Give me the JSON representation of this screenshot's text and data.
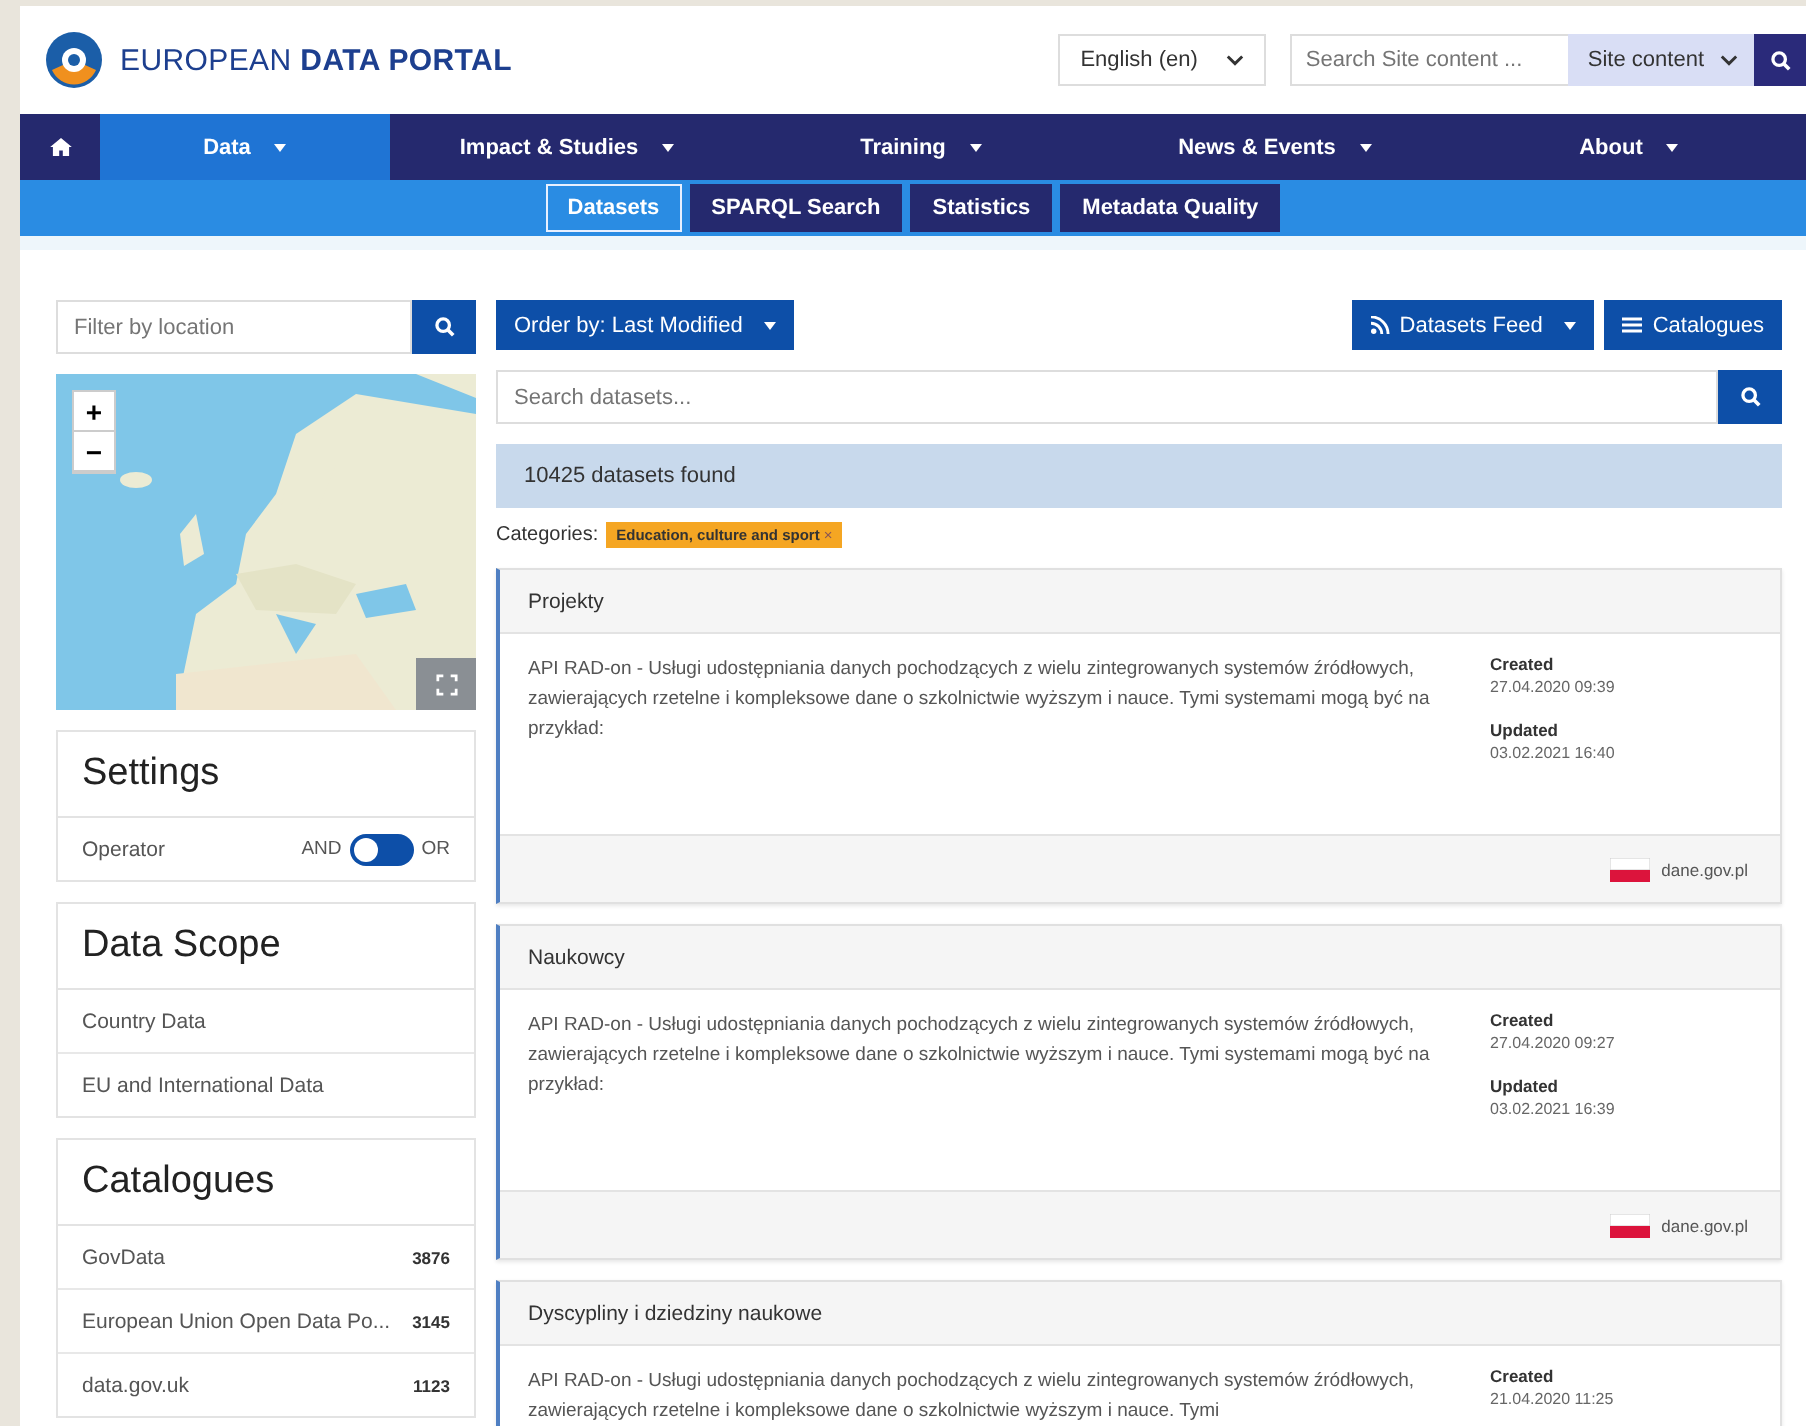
{
  "header": {
    "logo_text": "EUROPEAN **DATA PORTAL**",
    "language": "English (en)",
    "search_placeholder": "Search Site content ...",
    "search_scope": "Site content"
  },
  "nav": [
    {
      "kind": "home",
      "selected": false
    },
    {
      "kind": "menu",
      "label": "Data",
      "selected": true
    },
    {
      "kind": "menu",
      "label": "Impact & Studies",
      "selected": false
    },
    {
      "kind": "menu",
      "label": "Training",
      "selected": false
    },
    {
      "kind": "menu",
      "label": "News & Events",
      "selected": false
    },
    {
      "kind": "menu",
      "label": "About",
      "selected": false
    }
  ],
  "subnav": [
    {
      "label": "Datasets",
      "selected": true
    },
    {
      "label": "SPARQL Search",
      "selected": false
    },
    {
      "label": "Statistics",
      "selected": false
    },
    {
      "label": "Metadata Quality",
      "selected": false
    }
  ],
  "sidebar": {
    "location_placeholder": "Filter by location",
    "zoom_in": "+",
    "zoom_out": "−",
    "settings": {
      "title": "Settings",
      "operator_label": "Operator",
      "left_option": "AND",
      "right_option": "OR",
      "right_selected": false
    },
    "data_scope": {
      "title": "Data Scope",
      "items": [
        "Country Data",
        "EU and International Data"
      ]
    },
    "catalogues": {
      "title": "Catalogues",
      "items": [
        {
          "name": "GovData",
          "count": "3876"
        },
        {
          "name": "European Union Open Data Po...",
          "count": "3145"
        },
        {
          "name": "data.gov.uk",
          "count": "1123"
        }
      ]
    }
  },
  "main": {
    "order_by": "Order by: Last Modified",
    "feed_button": "Datasets Feed",
    "catalogues_button": "Catalogues",
    "search_placeholder": "Search datasets...",
    "found": "10425 datasets found",
    "categories_label": "Categories:",
    "tags": [
      {
        "label": "Education, culture and sport",
        "remove": "×"
      }
    ],
    "datasets": [
      {
        "title": "Projekty",
        "description": "API RAD-on - Usługi udostępniania danych pochodzących z wielu zintegrowanych systemów źródłowych, zawierających rzetelne i kompleksowe dane o szkolnictwie wyższym i nauce. Tymi systemami mogą być na przykład:",
        "created_label": "Created",
        "created": "27.04.2020 09:39",
        "updated_label": "Updated",
        "updated": "03.02.2021 16:40",
        "publisher": "dane.gov.pl"
      },
      {
        "title": "Naukowcy",
        "description": "API RAD-on - Usługi udostępniania danych pochodzących z wielu zintegrowanych systemów źródłowych, zawierających rzetelne i kompleksowe dane o szkolnictwie wyższym i nauce. Tymi systemami mogą być na przykład:",
        "created_label": "Created",
        "created": "27.04.2020 09:27",
        "updated_label": "Updated",
        "updated": "03.02.2021 16:39",
        "publisher": "dane.gov.pl"
      },
      {
        "title": "Dyscypliny i dziedziny naukowe",
        "description": "API RAD-on - Usługi udostępniania danych pochodzących z wielu zintegrowanych systemów źródłowych, zawierających rzetelne i kompleksowe dane o szkolnictwie wyższym i nauce. Tymi",
        "created_label": "Created",
        "created": "21.04.2020 11:25"
      }
    ]
  }
}
